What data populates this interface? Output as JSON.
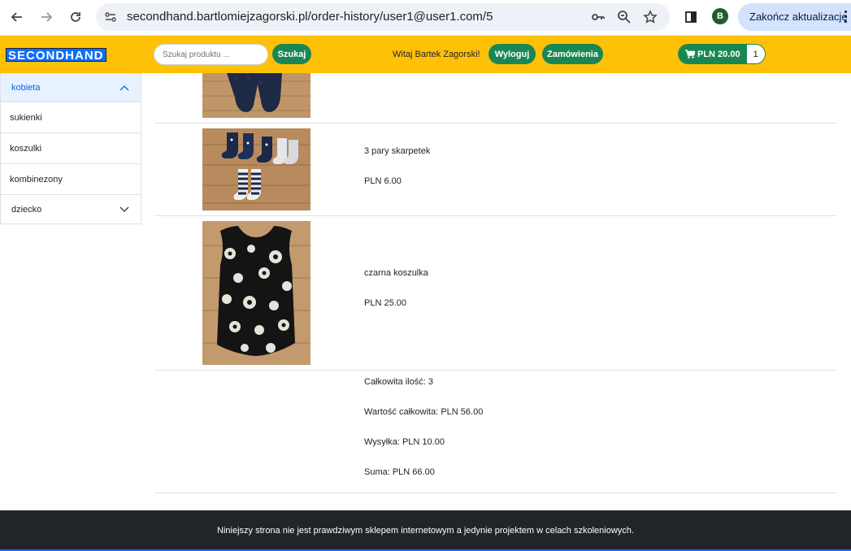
{
  "browser": {
    "url": "secondhand.bartlomiejzagorski.pl/order-history/user1@user1.com/5",
    "profile_initial": "B",
    "update_label": "Zakończ aktualizację"
  },
  "header": {
    "logo": "SECONDHAND",
    "search_placeholder": "Szukaj produktu ...",
    "search_button": "Szukaj",
    "welcome": "Witaj Bartek Zagorski!",
    "logout_button": "Wyloguj",
    "orders_button": "Zamówienia",
    "cart_total": "PLN 20.00",
    "cart_count": "1"
  },
  "sidebar": {
    "categories": [
      {
        "label": "kobieta",
        "expanded": true,
        "items": [
          "sukienki",
          "koszulki",
          "kombinezony"
        ]
      },
      {
        "label": "dziecko",
        "expanded": false
      }
    ]
  },
  "order": {
    "items": [
      {
        "name": "3 pary skarpetek",
        "price": "PLN 6.00"
      },
      {
        "name": "czarna koszulka",
        "price": "PLN 25.00"
      }
    ],
    "summary": {
      "quantity": "Całkowita ilość: 3",
      "total_value": "Wartość całkowita: PLN 56.00",
      "shipping": "Wysyłka: PLN 10.00",
      "sum": "Suma: PLN 66.00"
    }
  },
  "footer": {
    "text": "Niniejszy strona nie jest prawdziwym sklepem internetowym a jedynie projektem w celach szkoleniowych."
  },
  "colors": {
    "header_bg": "#ffc107",
    "button_green": "#198754",
    "logo_blue": "#0d6efd",
    "footer_bg": "#212529"
  }
}
